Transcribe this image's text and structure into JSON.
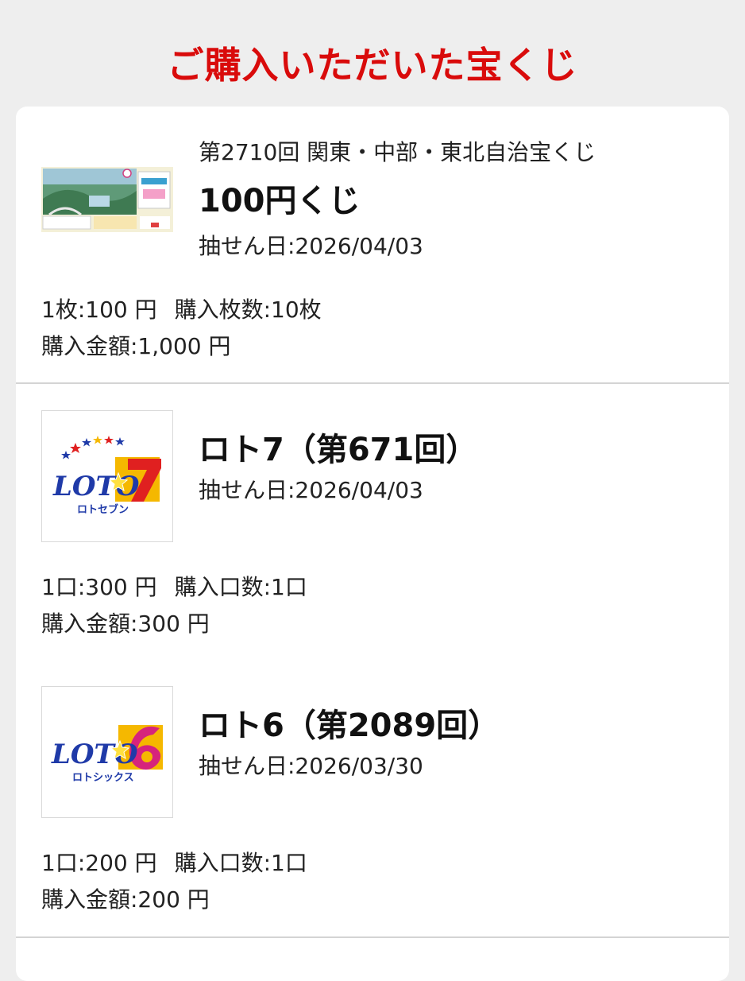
{
  "page": {
    "title": "ご購入いただいた宝くじ"
  },
  "purchases": [
    {
      "series": "第2710回 関東・中部・東北自治宝くじ",
      "name": "100円くじ",
      "draw_date": "抽せん日:2026/04/03",
      "unit_price": "1枚:100 円",
      "quantity": "購入枚数:10枚",
      "total": "購入金額:1,000 円",
      "thumbnail": "lottery-ticket-image"
    },
    {
      "name": "ロト7（第671回）",
      "draw_date": "抽せん日:2026/04/03",
      "unit_price": "1口:300 円",
      "quantity": "購入口数:1口",
      "total": "購入金額:300 円",
      "logo": {
        "wordmark": "LOTO",
        "number": "7",
        "kana": "ロトセブン"
      }
    },
    {
      "name": "ロト6（第2089回）",
      "draw_date": "抽せん日:2026/03/30",
      "unit_price": "1口:200 円",
      "quantity": "購入口数:1口",
      "total": "購入金額:200 円",
      "logo": {
        "wordmark": "LOTO",
        "number": "6",
        "kana": "ロトシックス"
      }
    }
  ],
  "colors": {
    "title_red": "#d90b0b",
    "loto_blue": "#1f3aa8",
    "loto7_red": "#e02020",
    "loto6_magenta": "#d6247c",
    "logo_yellow": "#f5b800"
  }
}
